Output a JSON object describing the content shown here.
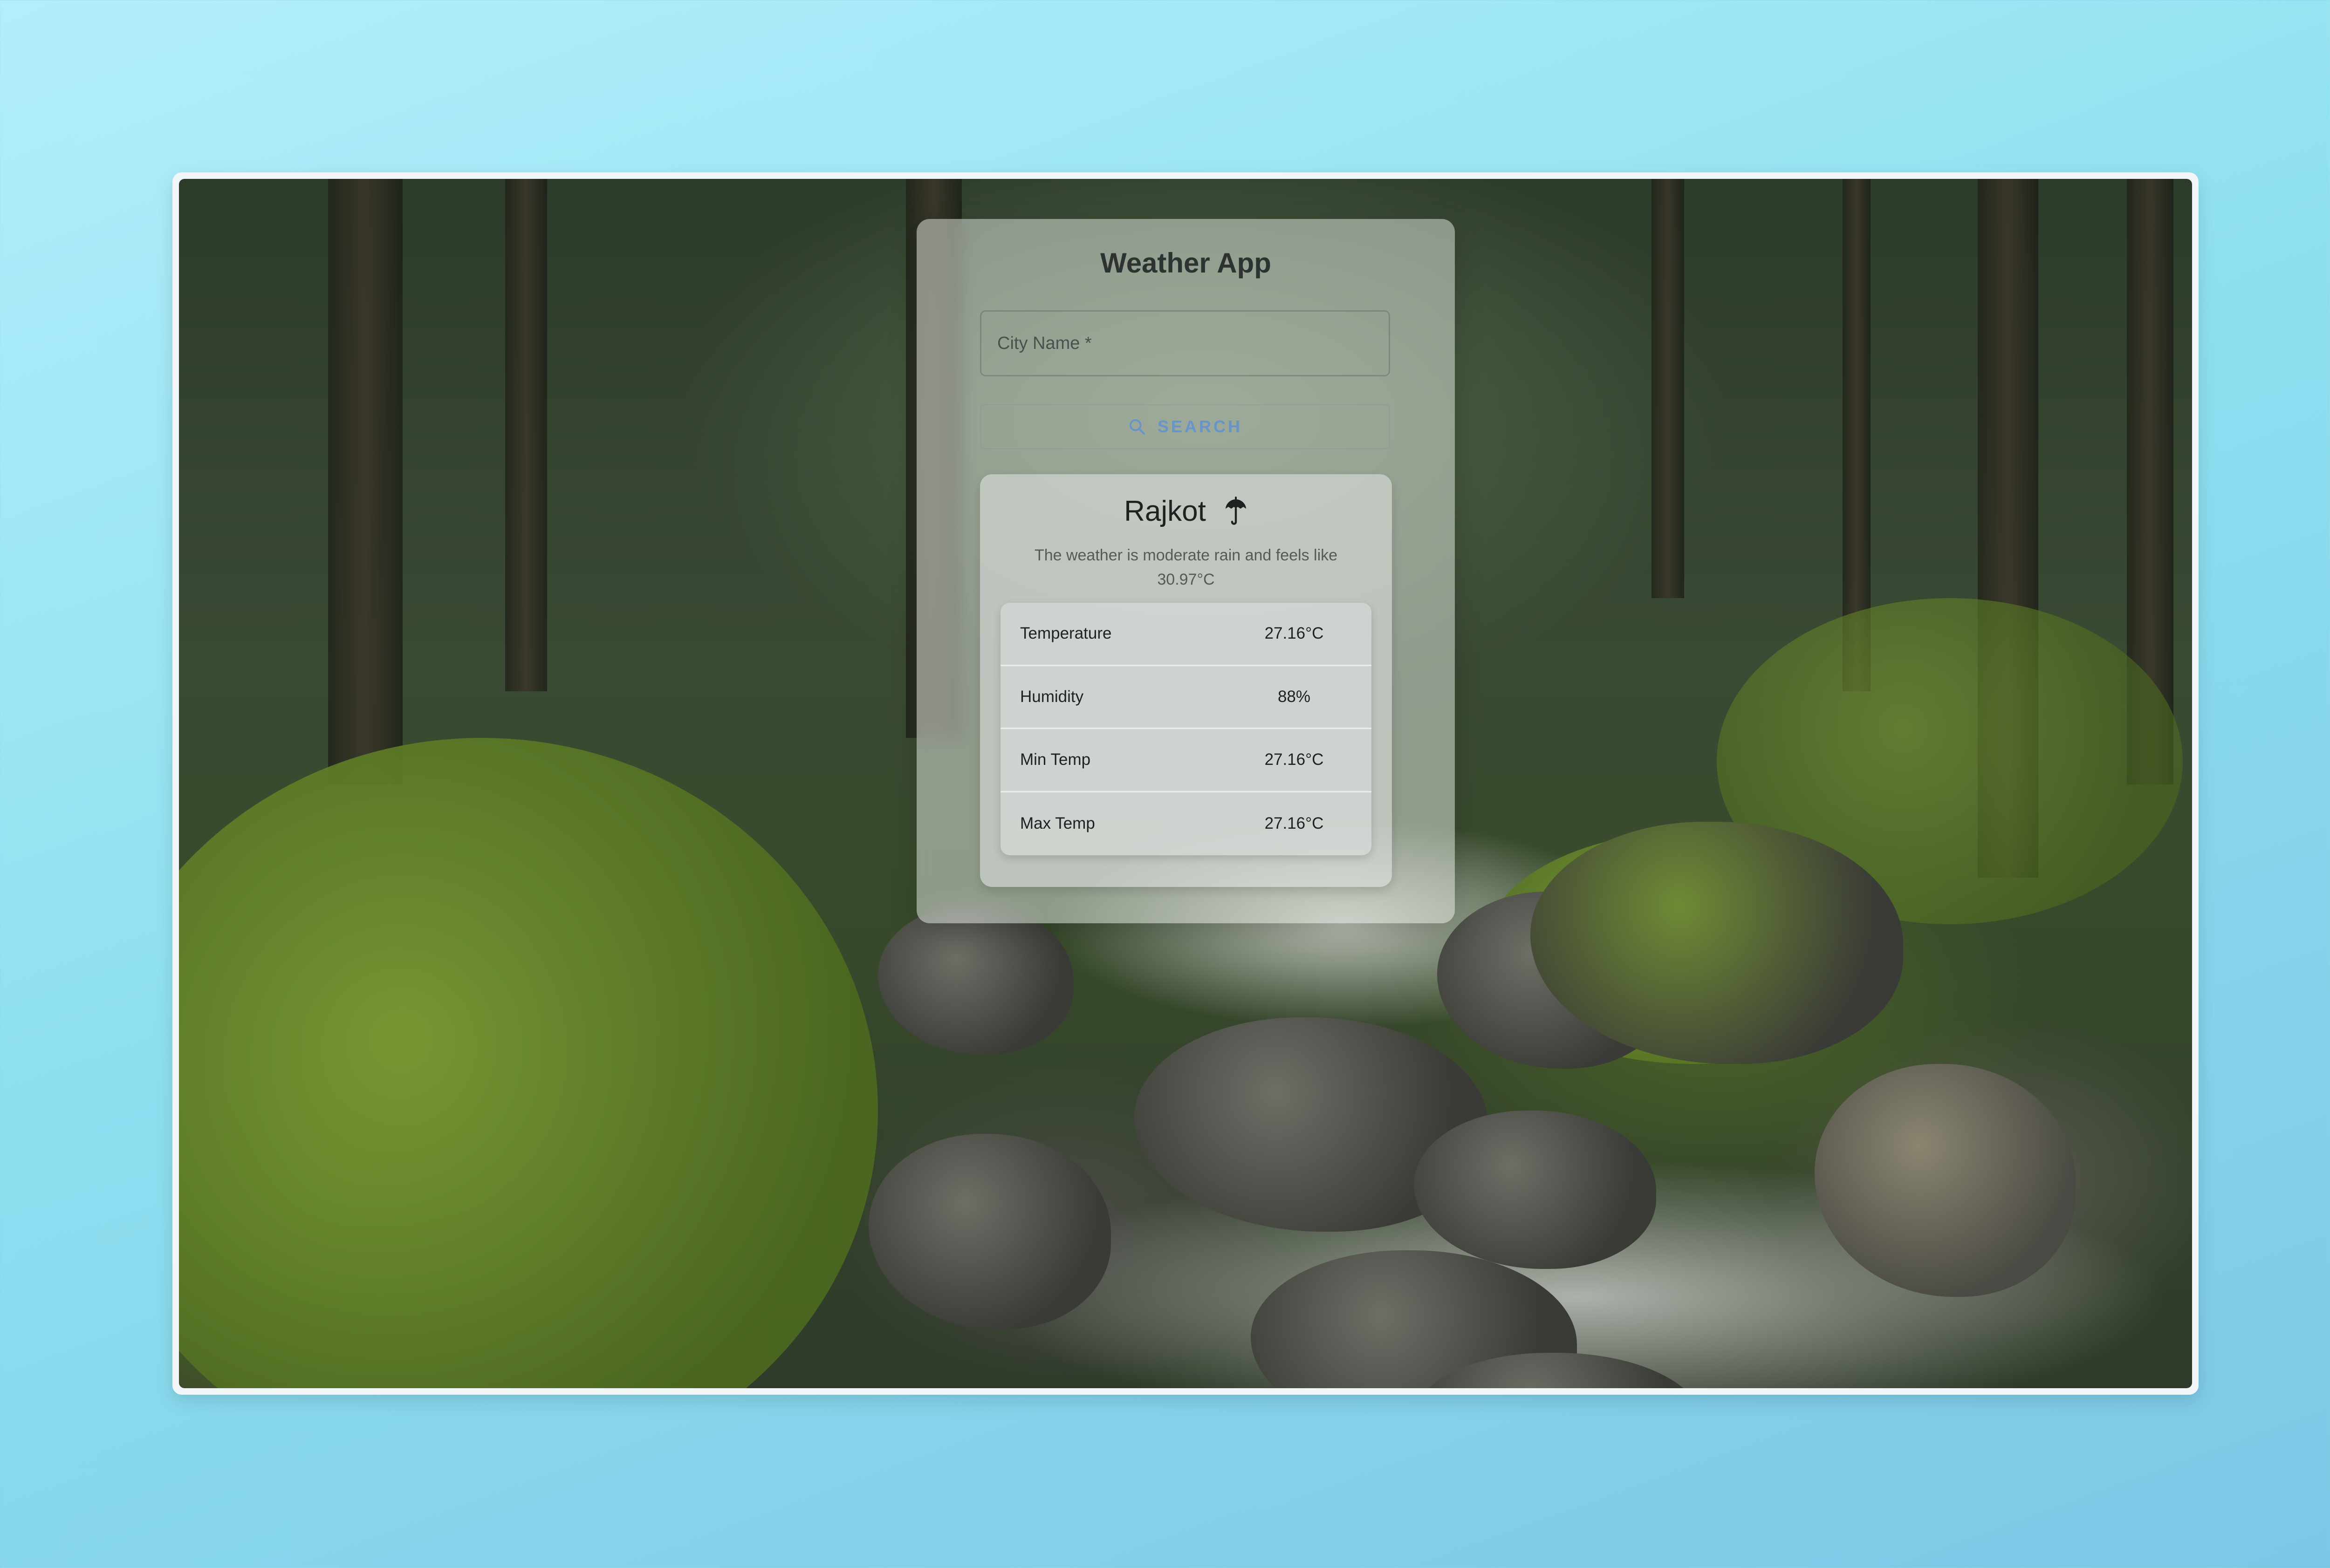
{
  "app": {
    "title": "Weather App"
  },
  "search": {
    "placeholder": "City Name *",
    "value": "",
    "button_label": "SEARCH",
    "button_icon": "search-icon"
  },
  "result": {
    "city": "Rajkot",
    "weather_icon": "umbrella-icon",
    "description": "The weather is moderate rain and feels like 30.97°C",
    "stats": [
      {
        "label": "Temperature",
        "value": "27.16°C"
      },
      {
        "label": "Humidity",
        "value": "88%"
      },
      {
        "label": "Min Temp",
        "value": "27.16°C"
      },
      {
        "label": "Max Temp",
        "value": "27.16°C"
      }
    ]
  },
  "colors": {
    "page_background": "#a6e6f5",
    "button_text": "#5a8fd6",
    "title_text": "#2d3331"
  }
}
